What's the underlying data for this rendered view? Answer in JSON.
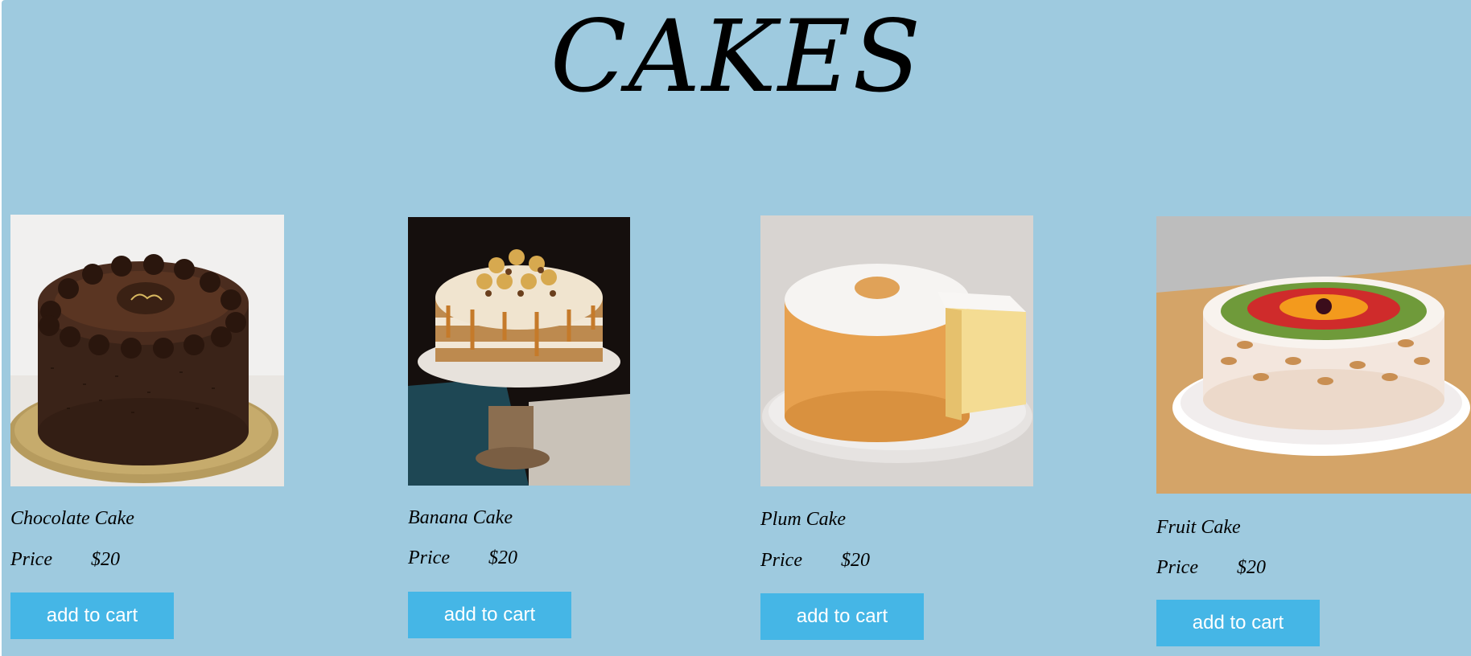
{
  "page": {
    "title": "CAKES"
  },
  "products": [
    {
      "name": "Chocolate Cake",
      "price_label": "Price",
      "price": "$20",
      "button_label": "add to cart",
      "image": "chocolate-cake-image"
    },
    {
      "name": "Banana Cake",
      "price_label": "Price",
      "price": "$20",
      "button_label": "add to cart",
      "image": "banana-cake-image"
    },
    {
      "name": "Plum Cake",
      "price_label": "Price",
      "price": "$20",
      "button_label": "add to cart",
      "image": "plum-cake-image"
    },
    {
      "name": "Fruit Cake",
      "price_label": "Price",
      "price": "$20",
      "button_label": "add to cart",
      "image": "fruit-cake-image"
    }
  ],
  "colors": {
    "background": "#9ecadf",
    "button": "#45b6e6",
    "button_text": "#ffffff"
  }
}
